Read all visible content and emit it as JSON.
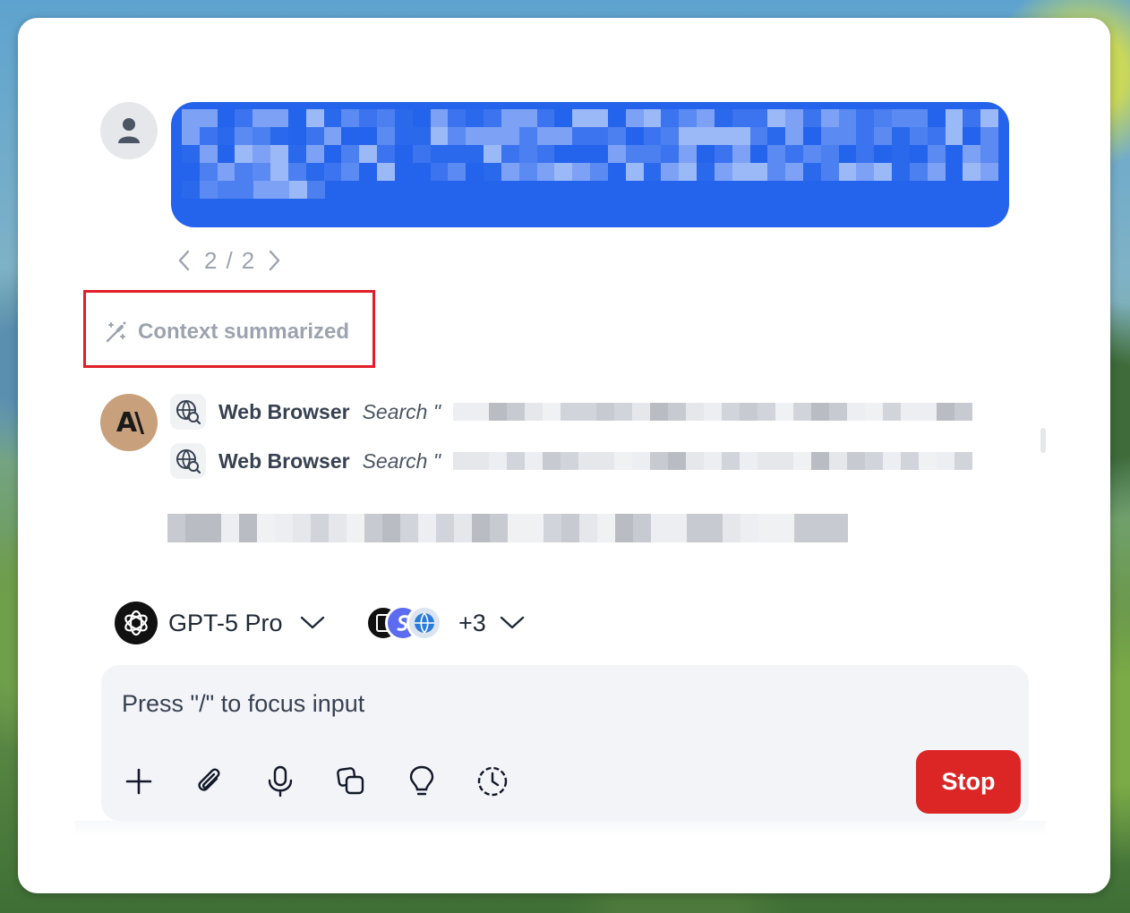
{
  "conversation": {
    "user_message": {
      "redacted": true,
      "bubble_color": "#2463eb"
    },
    "pager": {
      "current": "2",
      "separator": "/",
      "total": "2"
    },
    "context_notice": "Context summarized",
    "assistant": {
      "avatar_text": "A\\",
      "tool_calls": [
        {
          "name": "Web Browser",
          "action": "Search \"",
          "icon": "globe-search-icon"
        },
        {
          "name": "Web Browser",
          "action": "Search \"",
          "icon": "globe-search-icon"
        }
      ],
      "redacted_text": true
    }
  },
  "selectors": {
    "model_name": "GPT-5 Pro",
    "model_icon": "openai-logo-icon",
    "tools_extra_count": "+3"
  },
  "composer": {
    "placeholder": "Press \"/\" to focus input",
    "toolbar_icons": [
      "plus-icon",
      "paperclip-icon",
      "microphone-icon",
      "copy-icon",
      "lightbulb-icon",
      "history-icon"
    ],
    "stop_label": "Stop",
    "stop_color": "#dc2626"
  },
  "highlight_color": "#e11d2a"
}
